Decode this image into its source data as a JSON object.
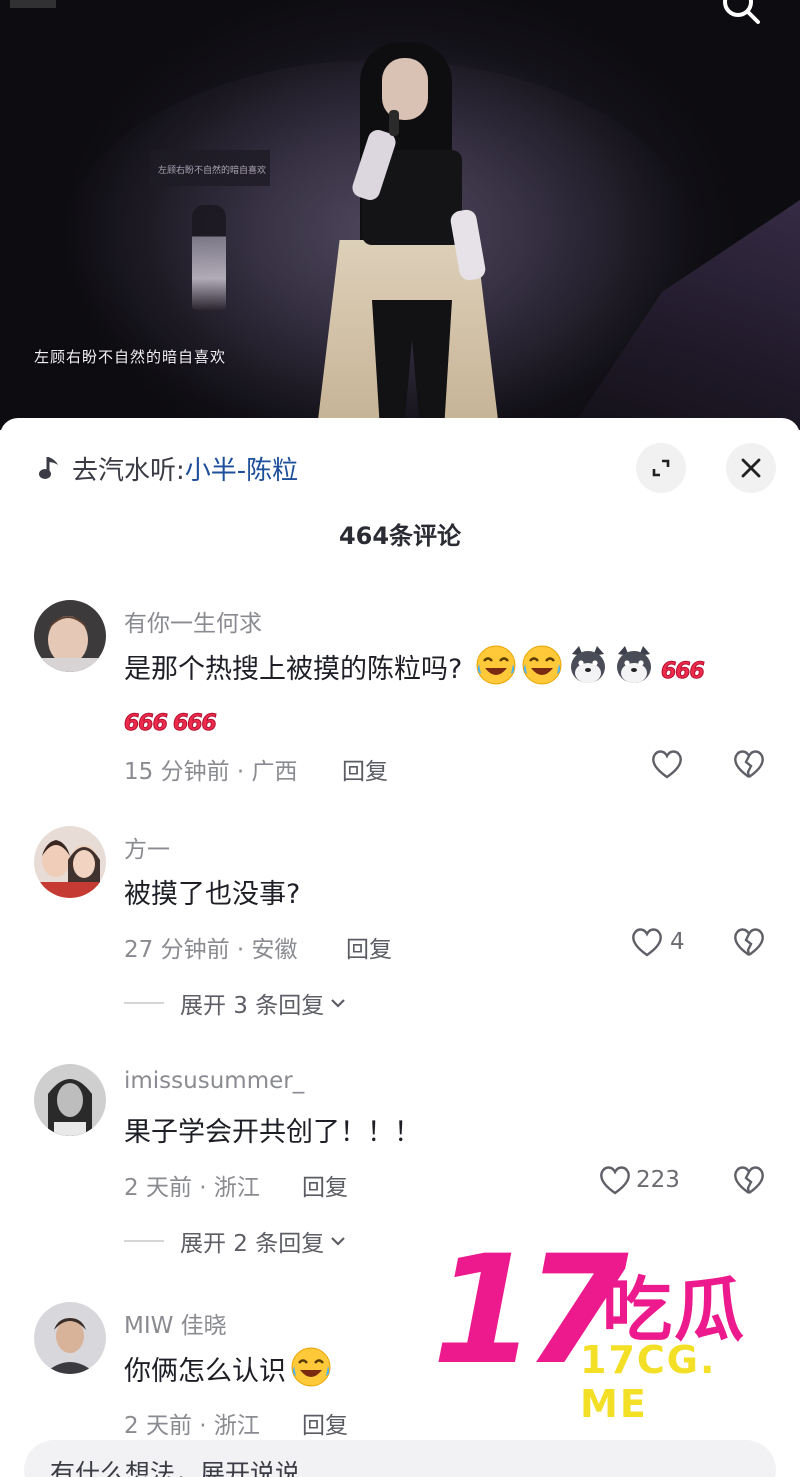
{
  "video": {
    "lyric": "左顾右盼不自然的暗自喜欢",
    "screen_caption": "左顾右盼不自然的暗自喜欢",
    "search_icon": "search-icon"
  },
  "sheet": {
    "music_prefix": "去汽水听:",
    "music_song": "小半-陈粒",
    "music_icon": "music-note-icon",
    "expand_icon": "expand-icon",
    "close_icon": "close-icon",
    "comment_count": "464条评论"
  },
  "comments": [
    {
      "user": "有你一生何求",
      "text": "是那个热搜上被摸的陈粒吗?",
      "emoji_666": "666",
      "time_location": "15 分钟前 · 广西",
      "reply_label": "回复",
      "likes": ""
    },
    {
      "user": "方一",
      "text": "被摸了也没事?",
      "time_location": "27 分钟前 · 安徽",
      "reply_label": "回复",
      "likes": "4",
      "expand_label": "展开 3 条回复"
    },
    {
      "user": "imissusummer_",
      "text": "果子学会开共创了！！！",
      "time_location": "2 天前 · 浙江",
      "reply_label": "回复",
      "likes": "223",
      "expand_label": "展开 2 条回复"
    },
    {
      "user": "MIW 佳晓",
      "text": "你俩怎么认识",
      "time_location": "2 天前 · 浙江",
      "reply_label": "回复"
    }
  ],
  "watermark": {
    "number": "17",
    "name": "吃瓜",
    "domain": "17CG. ME"
  },
  "input": {
    "placeholder": "有什么想法，展开说说"
  },
  "colors": {
    "accent_link": "#1d4f9a",
    "watermark_pink": "#ed1a8e",
    "watermark_yellow": "#f3df26"
  }
}
